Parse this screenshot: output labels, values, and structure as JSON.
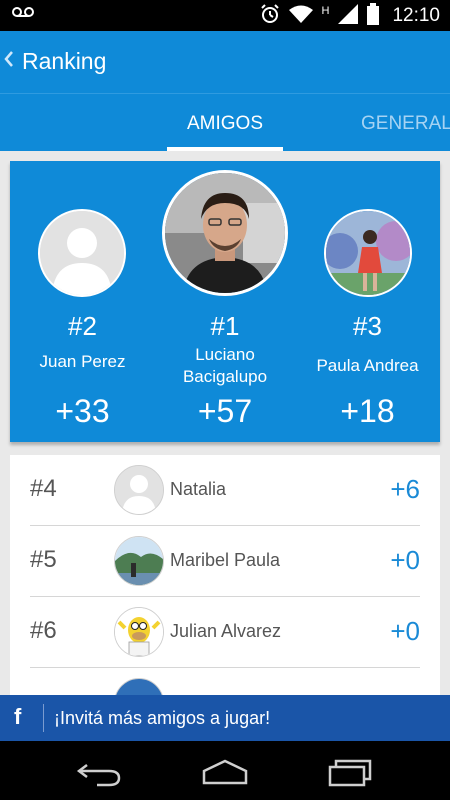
{
  "status_bar": {
    "time": "12:10",
    "network_type": "H",
    "icons": [
      "voicemail-icon",
      "alarm-icon",
      "wifi-icon",
      "signal-icon",
      "battery-icon"
    ]
  },
  "app_bar": {
    "title": "Ranking",
    "back_icon": "chevron-left-icon"
  },
  "tabs": [
    {
      "label": "AMIGOS",
      "selected": true
    },
    {
      "label": "GENERAL",
      "selected": false
    }
  ],
  "podium": [
    {
      "rank": "#2",
      "name": "Juan Perez",
      "points": "+33",
      "avatar": "blank-avatar"
    },
    {
      "rank": "#1",
      "name": "Luciano Bacigalupo",
      "name_line1": "Luciano",
      "name_line2": "Bacigalupo",
      "points": "+57",
      "avatar": "photo-man"
    },
    {
      "rank": "#3",
      "name": "Paula Andrea",
      "points": "+18",
      "avatar": "photo-woman"
    }
  ],
  "ranking_list": [
    {
      "rank": "#4",
      "name": "Natalia",
      "points": "+6",
      "avatar": "blank-avatar"
    },
    {
      "rank": "#5",
      "name": "Maribel Paula",
      "points": "+0",
      "avatar": "photo-landscape"
    },
    {
      "rank": "#6",
      "name": "Julian Alvarez",
      "points": "+0",
      "avatar": "photo-cartoon"
    }
  ],
  "facebook_banner": {
    "icon": "facebook-icon",
    "label": "¡Invitá más amigos a jugar!"
  },
  "nav_bar": {
    "buttons": [
      "back-icon",
      "home-icon",
      "recent-apps-icon"
    ]
  },
  "colors": {
    "primary": "#0f8ad8",
    "facebook": "#1a55a8",
    "points_text": "#1a8ad6"
  }
}
